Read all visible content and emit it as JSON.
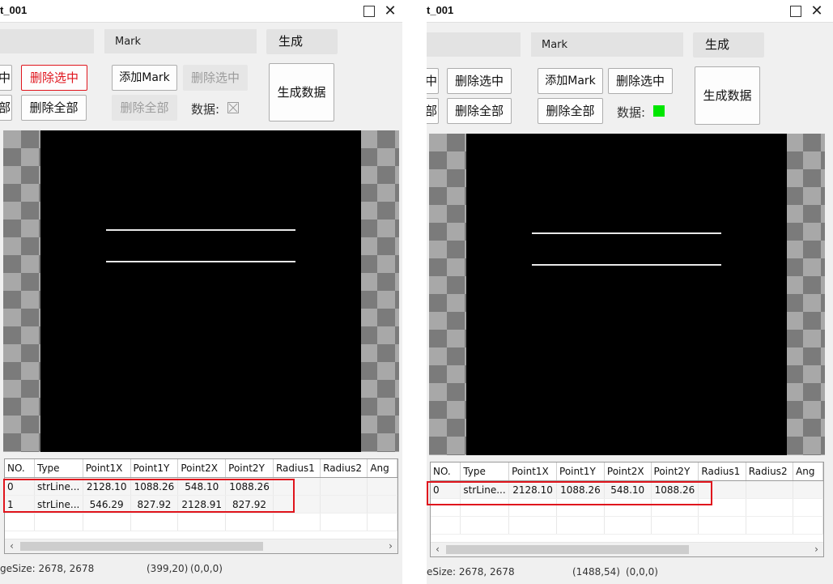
{
  "left": {
    "title": "t_001",
    "mark_field": "Mark",
    "buttons": {
      "generate": "生成",
      "cut_select": "中",
      "delete_selected_red": "删除选中",
      "cut_all": "部",
      "delete_all": "删除全部",
      "add_mark": "添加Mark",
      "delete_selected_disabled": "删除选中",
      "delete_all_disabled": "删除全部",
      "generate_data": "生成数据"
    },
    "data_label": "数据:",
    "data_state": "unchecked",
    "columns": [
      "NO.",
      "Type",
      "Point1X",
      "Point1Y",
      "Point2X",
      "Point2Y",
      "Radius1",
      "Radius2",
      "Ang"
    ],
    "rows": [
      [
        "0",
        "strLine...",
        "2128.10",
        "1088.26",
        "548.10",
        "1088.26",
        "",
        "",
        ""
      ],
      [
        "1",
        "strLine...",
        "546.29",
        "827.92",
        "2128.91",
        "827.92",
        "",
        "",
        ""
      ]
    ],
    "status": {
      "image_size": "geSize: 2678, 2678",
      "coords": "(399,20)",
      "rgb": "(0,0,0)"
    }
  },
  "right": {
    "title": "t_001",
    "mark_field": "Mark",
    "buttons": {
      "generate": "生成",
      "cut_select": "中",
      "delete_selected_left": "删除选中",
      "cut_all": "部",
      "delete_all_left": "删除全部",
      "add_mark": "添加Mark",
      "delete_selected": "删除选中",
      "delete_all": "删除全部",
      "generate_data": "生成数据"
    },
    "data_label": "数据:",
    "data_state": "green",
    "columns": [
      "NO.",
      "Type",
      "Point1X",
      "Point1Y",
      "Point2X",
      "Point2Y",
      "Radius1",
      "Radius2",
      "Ang"
    ],
    "rows": [
      [
        "0",
        "strLine...",
        "2128.10",
        "1088.26",
        "548.10",
        "1088.26",
        "",
        "",
        ""
      ]
    ],
    "status": {
      "image_size": "eSize: 2678, 2678",
      "coords": "(1488,54)",
      "rgb": "(0,0,0)"
    }
  },
  "colors": {
    "accent_red": "#e0151d",
    "indicator_green": "#00e600",
    "canvas_black": "#000000"
  }
}
